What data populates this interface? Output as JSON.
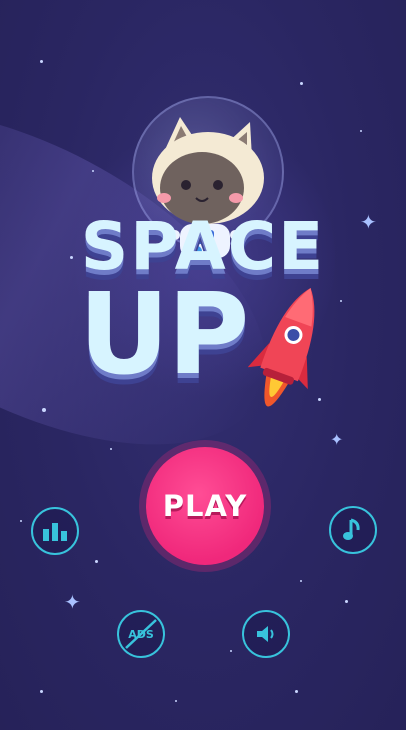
{
  "title": {
    "line1": "SPACE",
    "line2": "UP"
  },
  "play_button": {
    "label": "PLAY"
  },
  "buttons": {
    "leaderboard": {
      "icon": "bar-chart-icon"
    },
    "music": {
      "icon": "music-note-icon"
    },
    "no_ads": {
      "icon": "no-ads-icon",
      "label": "ADS"
    },
    "sound": {
      "icon": "speaker-icon"
    }
  },
  "colors": {
    "background": "#2b2763",
    "accent_pink": "#f0287b",
    "button_cyan": "#38c3dc",
    "title_text": "#d7f4ff"
  }
}
